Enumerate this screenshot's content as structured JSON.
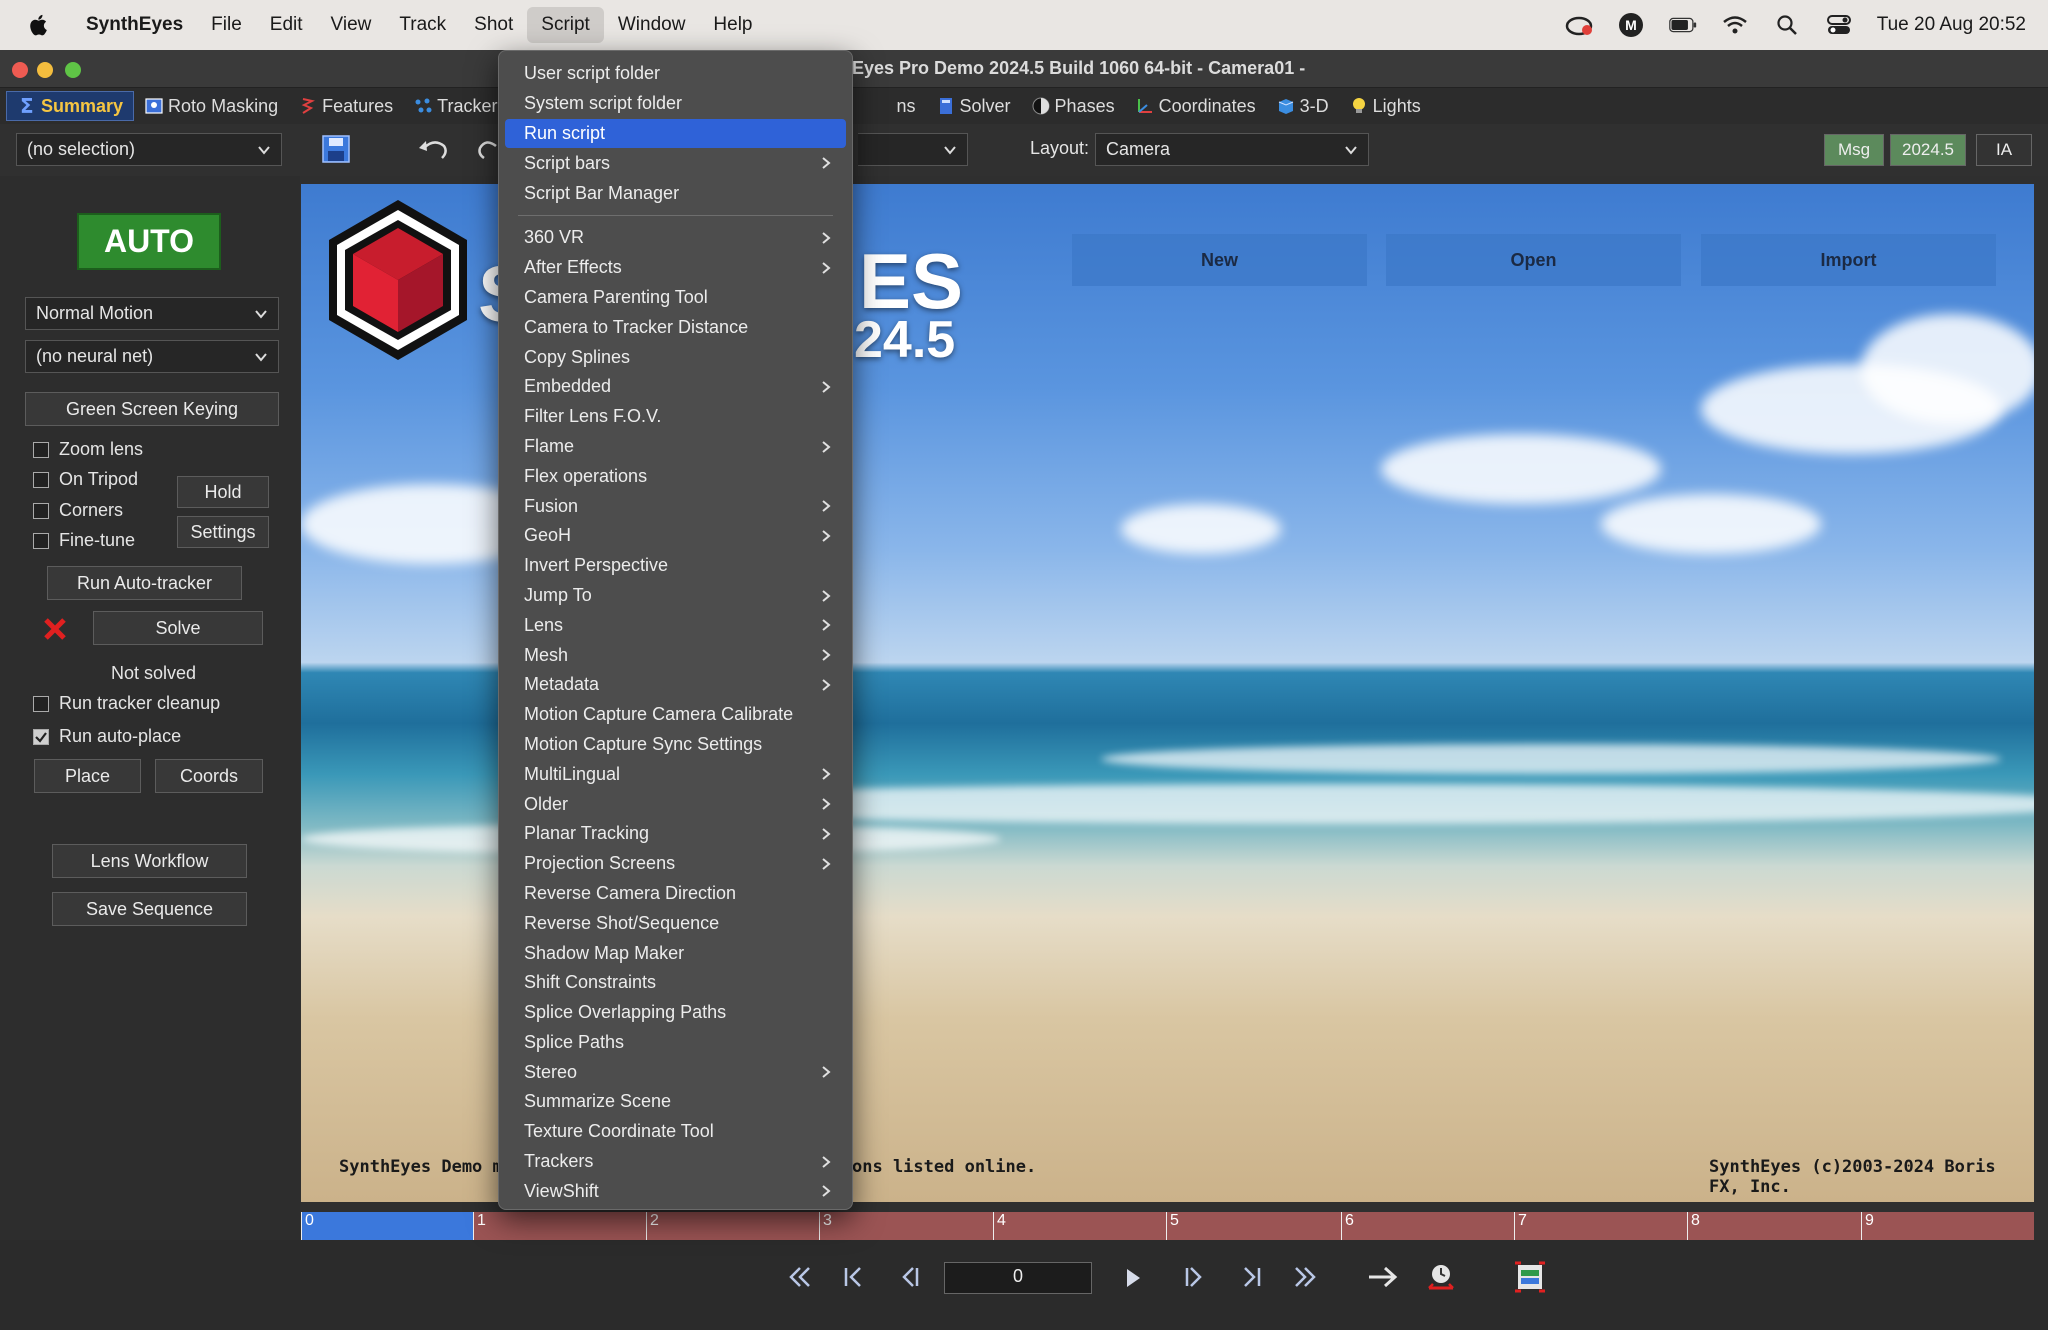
{
  "menubar": {
    "app": "SynthEyes",
    "items": [
      "File",
      "Edit",
      "View",
      "Track",
      "Shot",
      "Script",
      "Window",
      "Help"
    ],
    "active": "Script",
    "clock": "Tue 20 Aug  20:52"
  },
  "window": {
    "title": "Eyes Pro Demo 2024.5 Build 1060 64-bit - Camera01 -"
  },
  "tabs": {
    "summary": "Summary",
    "roto": "Roto Masking",
    "features": "Features",
    "trackers": "Trackers",
    "ns": "ns",
    "solver": "Solver",
    "phases": "Phases",
    "coordinates": "Coordinates",
    "threed": "3-D",
    "lights": "Lights"
  },
  "toolbar": {
    "selection": "(no selection)",
    "layout_label": "Layout:",
    "layout_value": "Camera",
    "msg": "Msg",
    "version": "2024.5",
    "ia": "IA"
  },
  "left": {
    "auto": "AUTO",
    "motion": "Normal Motion",
    "neural": "(no neural net)",
    "green_screen": "Green Screen Keying",
    "zoom_lens": "Zoom lens",
    "on_tripod": "On Tripod",
    "corners": "Corners",
    "fine_tune": "Fine-tune",
    "hold": "Hold",
    "settings": "Settings",
    "run_auto_tracker": "Run Auto-tracker",
    "solve": "Solve",
    "status": "Not solved",
    "run_tracker_cleanup": "Run tracker cleanup",
    "run_auto_place": "Run auto-place",
    "place": "Place",
    "coords": "Coords",
    "lens_workflow": "Lens Workflow",
    "save_sequence": "Save Sequence"
  },
  "checks": {
    "zoom_lens": false,
    "on_tripod": false,
    "corners": false,
    "fine_tune": false,
    "run_tracker_cleanup": false,
    "run_auto_place": true
  },
  "viewport": {
    "new": "New",
    "open": "Open",
    "import": "Import",
    "logo_big": "ES",
    "logo_ver": "24.5",
    "logo_s": "S",
    "foot_left": "SynthEyes Demo m",
    "foot_mid": "ons listed online.",
    "foot_right": "SynthEyes (c)2003-2024 Boris FX, Inc."
  },
  "timeline": {
    "ticks": [
      "0",
      "1",
      "2",
      "3",
      "4",
      "5",
      "6",
      "7",
      "8",
      "9"
    ]
  },
  "transport": {
    "frame": "0"
  },
  "script_menu": {
    "group1": [
      {
        "label": "User script folder",
        "sub": false
      },
      {
        "label": "System script folder",
        "sub": false
      },
      {
        "label": "Run script",
        "sub": false,
        "highlight": true
      },
      {
        "label": "Script bars",
        "sub": true
      },
      {
        "label": "Script Bar Manager",
        "sub": false
      }
    ],
    "group2": [
      {
        "label": "360 VR",
        "sub": true
      },
      {
        "label": "After Effects",
        "sub": true
      },
      {
        "label": "Camera Parenting Tool",
        "sub": false
      },
      {
        "label": "Camera to Tracker Distance",
        "sub": false
      },
      {
        "label": "Copy Splines",
        "sub": false
      },
      {
        "label": "Embedded",
        "sub": true
      },
      {
        "label": "Filter Lens F.O.V.",
        "sub": false
      },
      {
        "label": "Flame",
        "sub": true
      },
      {
        "label": "Flex operations",
        "sub": false
      },
      {
        "label": "Fusion",
        "sub": true
      },
      {
        "label": "GeoH",
        "sub": true
      },
      {
        "label": "Invert Perspective",
        "sub": false
      },
      {
        "label": "Jump To",
        "sub": true
      },
      {
        "label": "Lens",
        "sub": true
      },
      {
        "label": "Mesh",
        "sub": true
      },
      {
        "label": "Metadata",
        "sub": true
      },
      {
        "label": "Motion Capture Camera Calibrate",
        "sub": false
      },
      {
        "label": "Motion Capture Sync Settings",
        "sub": false
      },
      {
        "label": "MultiLingual",
        "sub": true
      },
      {
        "label": "Older",
        "sub": true
      },
      {
        "label": "Planar Tracking",
        "sub": true
      },
      {
        "label": "Projection Screens",
        "sub": true
      },
      {
        "label": "Reverse Camera Direction",
        "sub": false
      },
      {
        "label": "Reverse Shot/Sequence",
        "sub": false
      },
      {
        "label": "Shadow Map Maker",
        "sub": false
      },
      {
        "label": "Shift Constraints",
        "sub": false
      },
      {
        "label": "Splice Overlapping Paths",
        "sub": false
      },
      {
        "label": "Splice Paths",
        "sub": false
      },
      {
        "label": "Stereo",
        "sub": true
      },
      {
        "label": "Summarize Scene",
        "sub": false
      },
      {
        "label": "Texture Coordinate Tool",
        "sub": false
      },
      {
        "label": "Trackers",
        "sub": true
      },
      {
        "label": "ViewShift",
        "sub": true
      }
    ]
  },
  "colors": {
    "accent": "#2f62d8",
    "auto_green": "#2e8b2e",
    "timeline_red": "#9b5454",
    "timeline_blue": "#3b78dc"
  }
}
